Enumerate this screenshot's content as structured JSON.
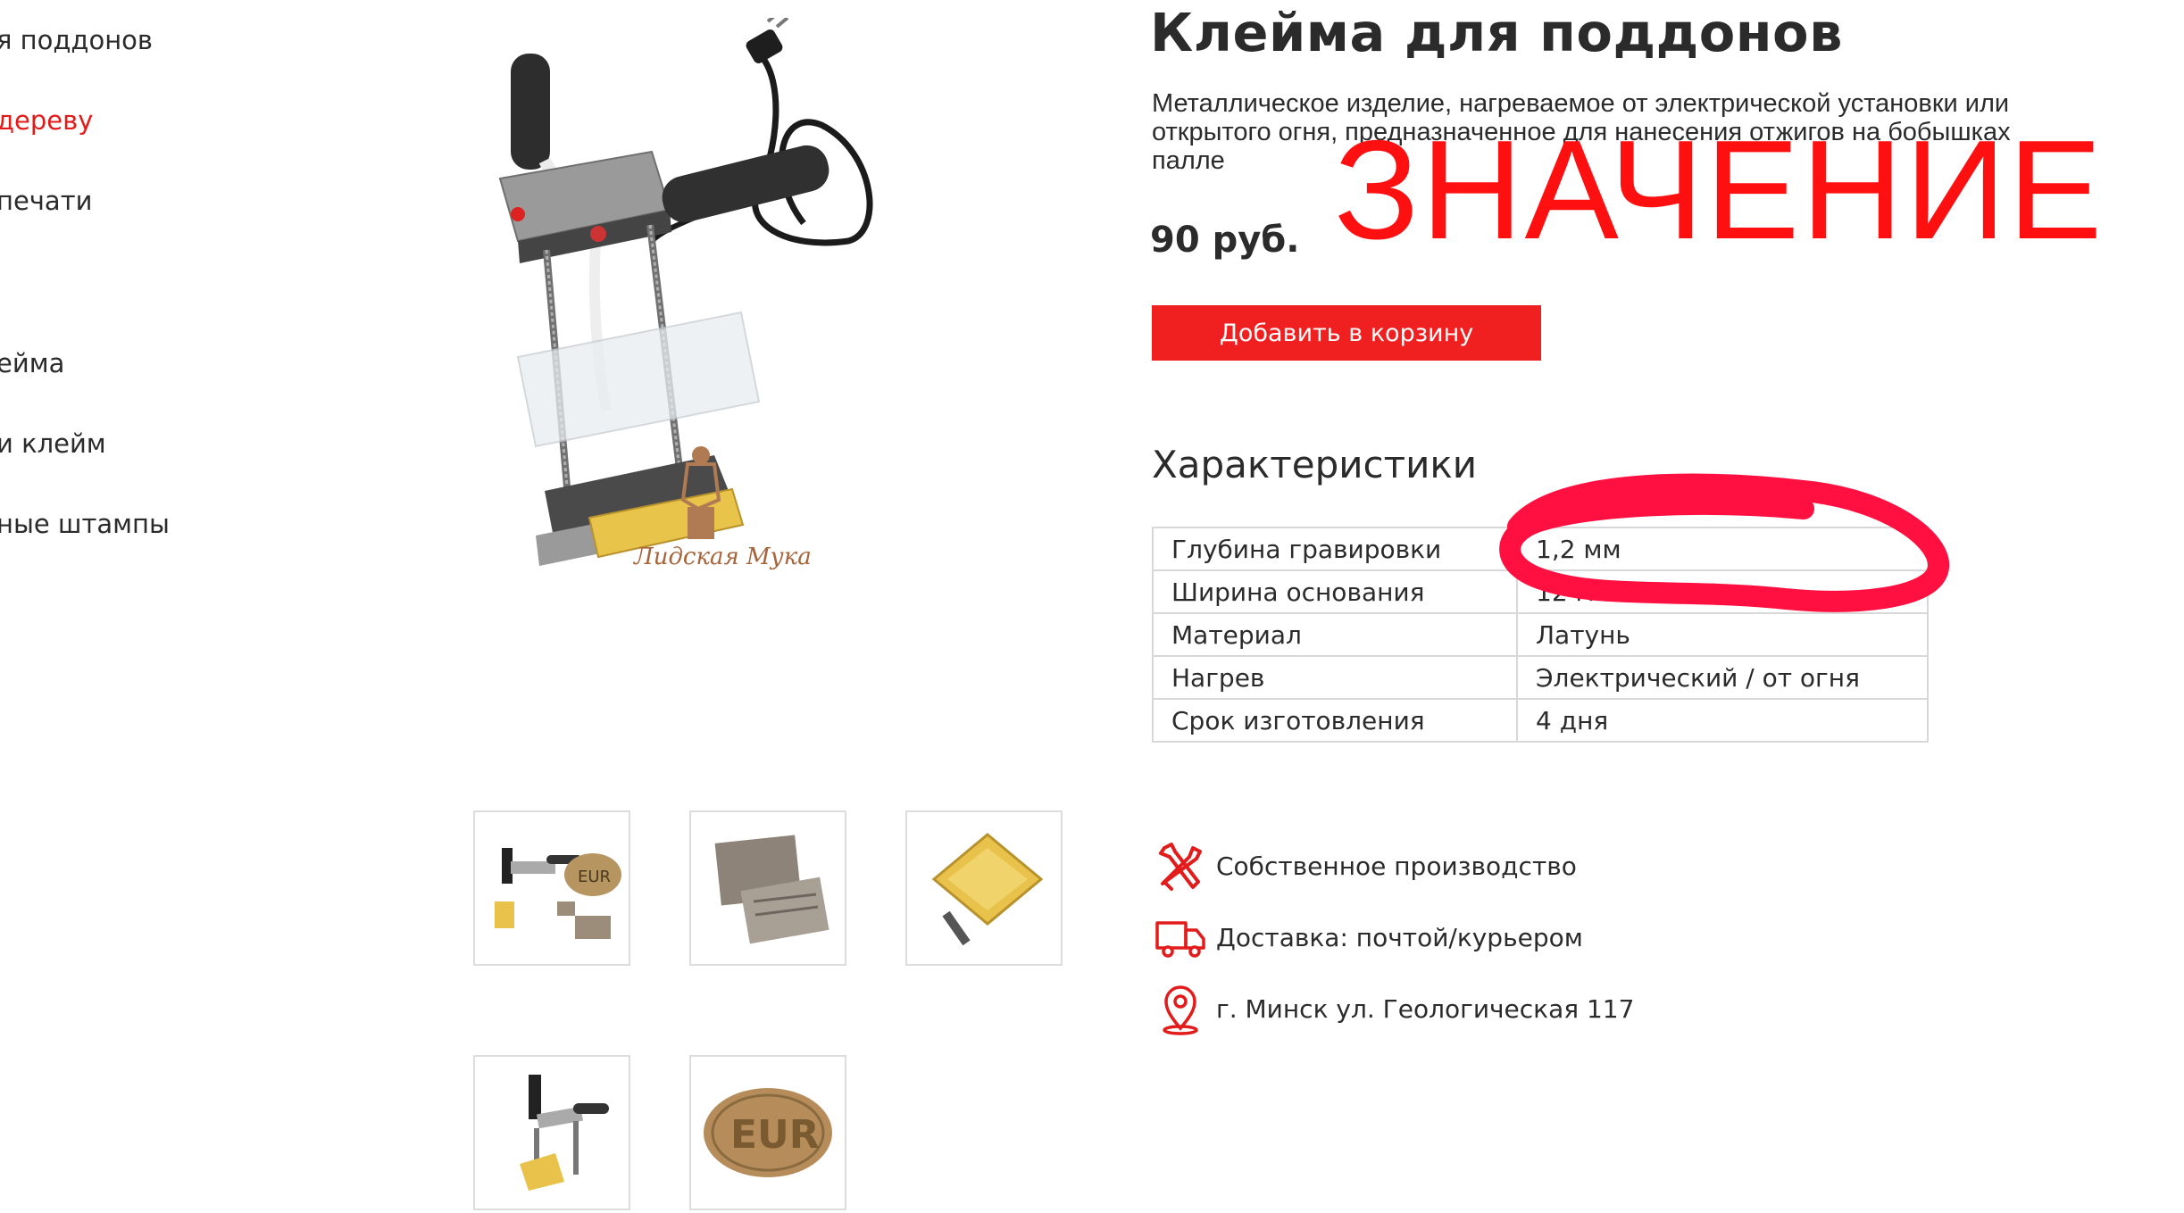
{
  "sidebar": {
    "items": [
      {
        "label": "я поддонов",
        "active": false
      },
      {
        "label": "дереву",
        "active": true
      },
      {
        "label": "печати",
        "active": false
      },
      {
        "label": "ейма",
        "active": false
      },
      {
        "label": "и клейм",
        "active": false
      },
      {
        "label": "ные штампы",
        "active": false
      }
    ]
  },
  "product": {
    "title": "Клейма для поддонов",
    "description": "Металлическое изделие, нагреваемое от электрической установки или открытого огня, предназначенное для нанесения отжигов на бобышках палле",
    "price": "90 руб.",
    "add_to_cart_label": "Добавить в корзину",
    "logo_text": "Лидская Мука"
  },
  "gallery": {
    "thumbnails": [
      {
        "name": "thumb-branding-iron-set"
      },
      {
        "name": "thumb-metal-stamps"
      },
      {
        "name": "thumb-brass-stamp"
      },
      {
        "name": "thumb-branding-iron"
      },
      {
        "name": "thumb-eur-stamp",
        "caption": "EUR"
      }
    ]
  },
  "characteristics": {
    "title": "Характеристики",
    "rows": [
      {
        "key": "Глубина гравировки",
        "value": "1,2 мм"
      },
      {
        "key": "Ширина основания",
        "value": "12 мм"
      },
      {
        "key": "Материал",
        "value": "Латунь"
      },
      {
        "key": "Нагрев",
        "value": "Электрический / от огня"
      },
      {
        "key": "Срок изготовления",
        "value": "4 дня"
      }
    ]
  },
  "features": [
    {
      "icon": "tools-icon",
      "text": "Собственное производство"
    },
    {
      "icon": "delivery-truck-icon",
      "text": "Доставка: почтой/курьером"
    },
    {
      "icon": "location-pin-icon",
      "text": "г. Минск ул. Геологическая 117"
    }
  ],
  "annotation": {
    "overlay_word": "ЗНАЧЕНИЕ",
    "color": "#ff1010"
  },
  "colors": {
    "accent": "#f12020",
    "text": "#2b2b2b",
    "border": "#d8d8d8"
  }
}
